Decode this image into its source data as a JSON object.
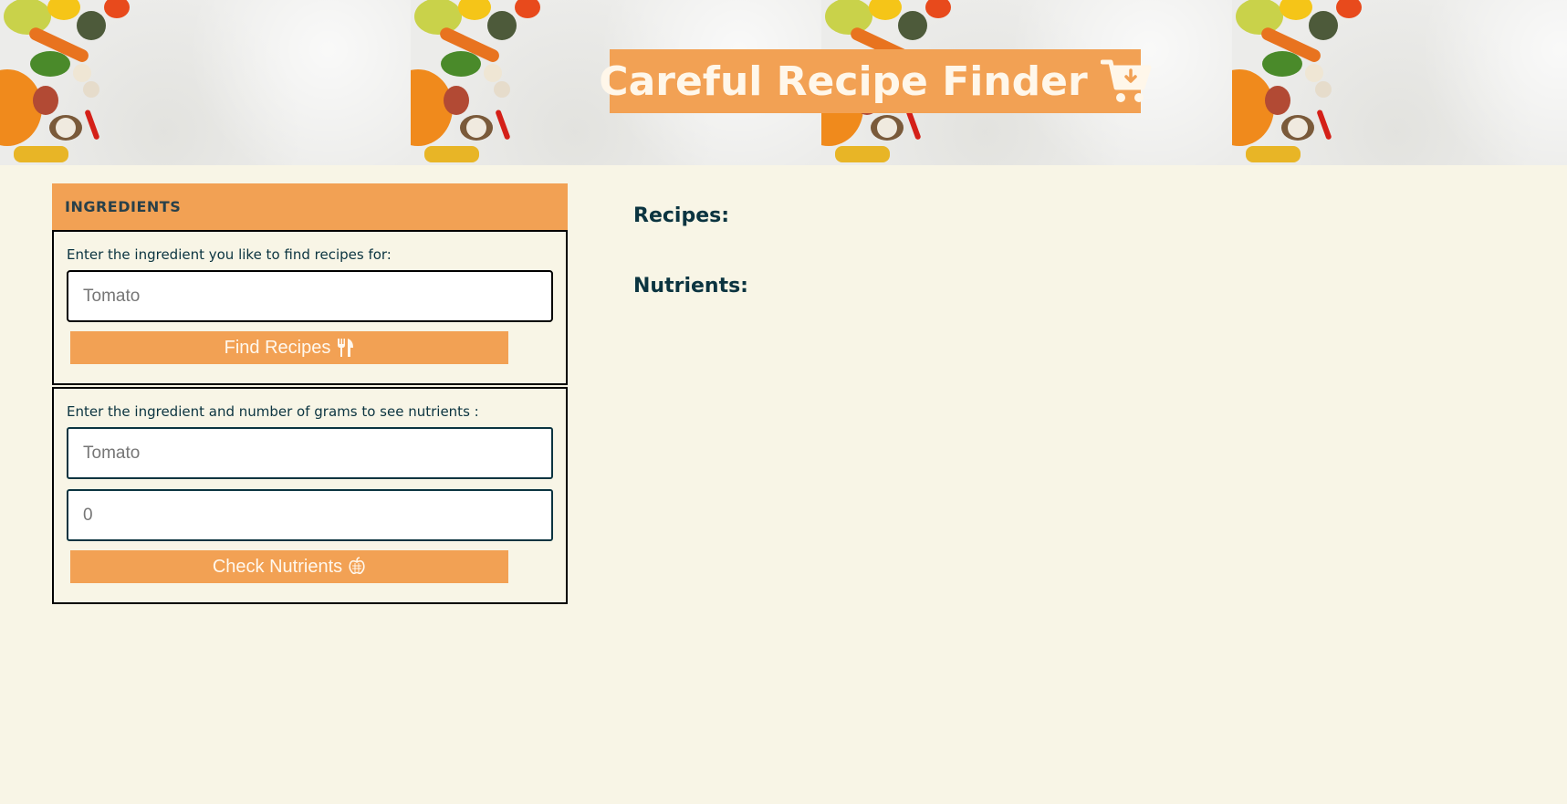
{
  "header": {
    "title": "Careful Recipe Finder",
    "icon": "cart-download-icon"
  },
  "ingredients_panel": {
    "heading": "INGREDIENTS",
    "recipe_section": {
      "label": "Enter the ingredient you like to find recipes for:",
      "placeholder": "Tomato",
      "button_label": "Find Recipes",
      "button_icon": "utensils-icon"
    },
    "nutrient_section": {
      "label": "Enter the ingredient and number of grams to see nutrients :",
      "ingredient_placeholder": "Tomato",
      "grams_placeholder": "0",
      "button_label": "Check Nutrients",
      "button_icon": "apple-icon"
    }
  },
  "results": {
    "recipes_heading": "Recipes:",
    "nutrients_heading": "Nutrients:"
  },
  "colors": {
    "accent": "#f2a154",
    "background": "#f8f5e6",
    "text": "#0b3440"
  }
}
